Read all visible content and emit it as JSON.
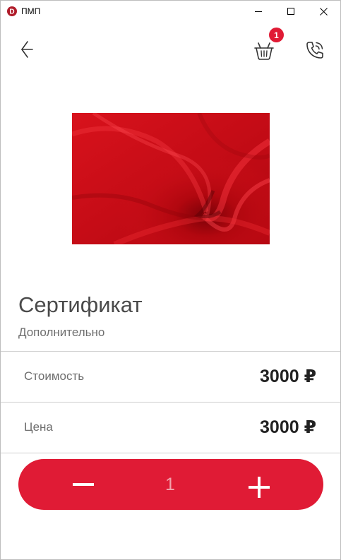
{
  "window": {
    "title": "ПМП",
    "logo_letter": "D",
    "controls": [
      "minimize-icon",
      "maximize-icon",
      "close-icon"
    ]
  },
  "header": {
    "back_icon": "arrow-left-icon",
    "cart_icon": "basket-icon",
    "cart_count": "1",
    "phone_icon": "phone-call-icon"
  },
  "product": {
    "image": "red-fabric-photo",
    "title": "Сертификат",
    "subtitle": "Дополнительно",
    "rows": [
      {
        "label": "Стоимость",
        "value": "3000 ₽"
      },
      {
        "label": "Цена",
        "value": "3000 ₽"
      }
    ]
  },
  "stepper": {
    "minus_icon": "minus-icon",
    "quantity": "1",
    "plus_icon": "plus-icon"
  },
  "colors": {
    "accent": "#e01b35",
    "quantity_text": "#f3a2ac",
    "title_text": "#4a4a4a",
    "muted_text": "#6e6e6e"
  }
}
